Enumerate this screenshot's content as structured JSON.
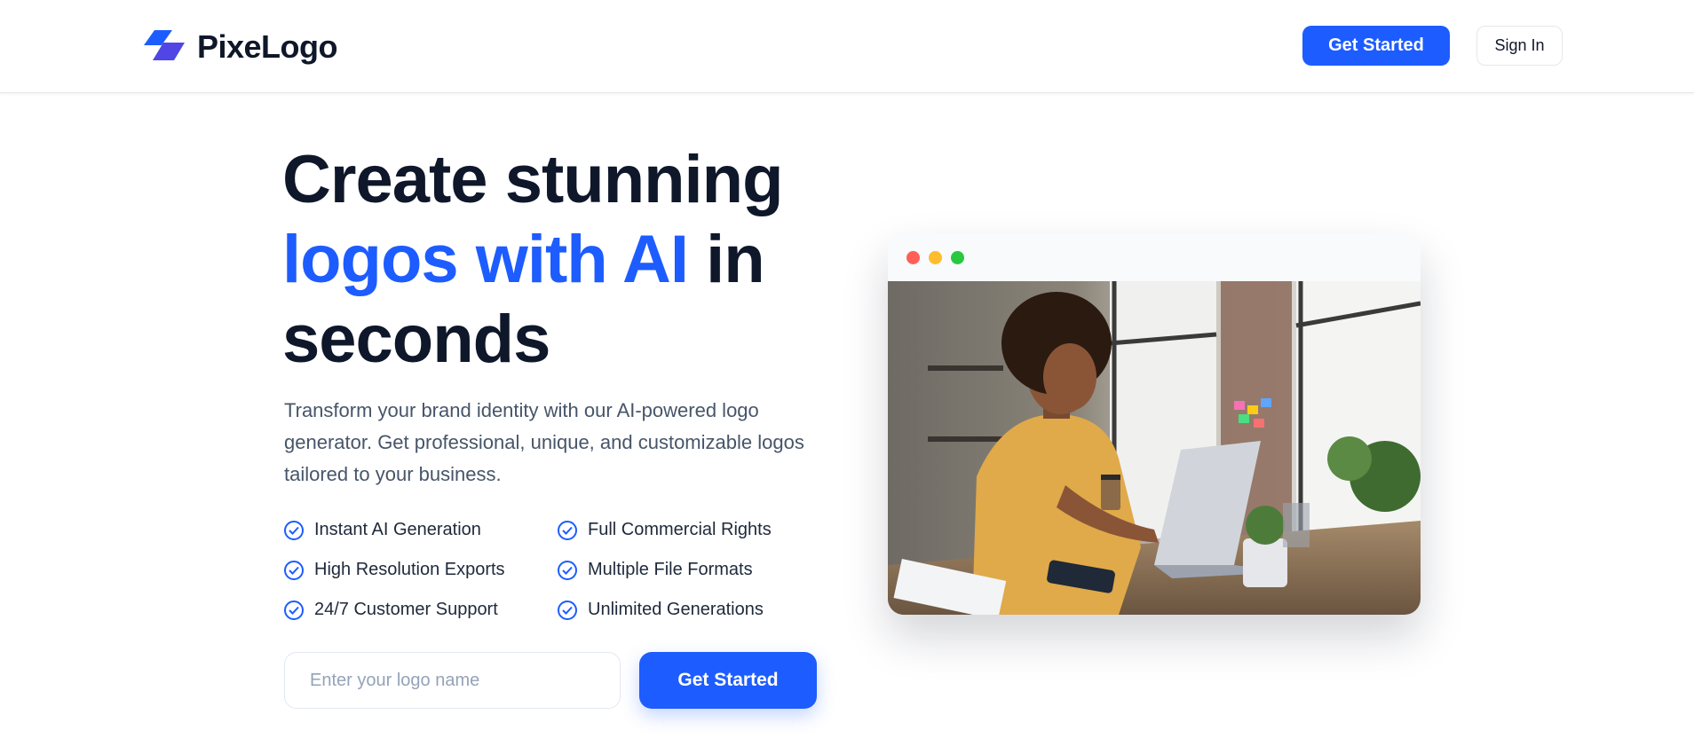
{
  "brand": {
    "name": "PixeLogo"
  },
  "header": {
    "get_started_label": "Get Started",
    "sign_in_label": "Sign In"
  },
  "hero": {
    "headline_part1": "Create stunning",
    "headline_accent": "logos with AI",
    "headline_part2": " in",
    "headline_part3": "seconds",
    "subtext": "Transform your brand identity with our AI-powered logo generator. Get professional, unique, and customizable logos tailored to your business.",
    "features": [
      "Instant AI Generation",
      "Full Commercial Rights",
      "High Resolution Exports",
      "Multiple File Formats",
      "24/7 Customer Support",
      "Unlimited Generations"
    ],
    "input_placeholder": "Enter your logo name",
    "cta_label": "Get Started"
  },
  "mockup": {
    "window_dots": [
      "#ff5f57",
      "#febc2e",
      "#28c840"
    ],
    "image": "woman-working-on-laptop-photo"
  },
  "colors": {
    "accent": "#1d5cff",
    "text": "#0f172a",
    "muted": "#475569"
  }
}
